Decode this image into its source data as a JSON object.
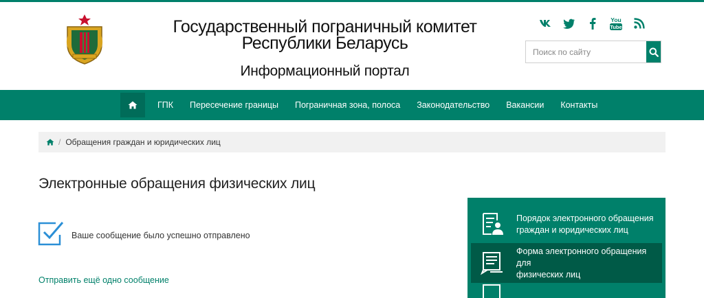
{
  "header": {
    "title_line1": "Государственный пограничный комитет",
    "title_line2": "Республики Беларусь",
    "subtitle": "Информационный портал"
  },
  "socials": [
    {
      "name": "vk-icon"
    },
    {
      "name": "twitter-icon"
    },
    {
      "name": "facebook-icon"
    },
    {
      "name": "youtube-icon",
      "text_top": "You",
      "text_bottom": "Tube"
    },
    {
      "name": "rss-icon"
    }
  ],
  "search": {
    "placeholder": "Поиск по сайту"
  },
  "nav": {
    "items": [
      "ГПК",
      "Пересечение границы",
      "Пограничная зона, полоса",
      "Законодательство",
      "Вакансии",
      "Контакты"
    ]
  },
  "breadcrumb": {
    "current": "Обращения граждан и юридических лиц",
    "separator": "/"
  },
  "main": {
    "title": "Электронные обращения физических лиц",
    "success_message": "Ваше сообщение было успешно отправлено",
    "send_again_link": "Отправить ещё одно сообщение"
  },
  "sidebar": {
    "items": [
      {
        "line1": "Порядок электронного обращения",
        "line2": "граждан и юридических лиц",
        "active": false
      },
      {
        "line1": "Форма электронного обращения для",
        "line2": "физических лиц",
        "active": true
      }
    ]
  },
  "colors": {
    "accent": "#00806a",
    "accent_dark": "#005a47",
    "breadcrumb_bg": "#f1f1f1",
    "icon_blue": "#2b8fd6"
  }
}
